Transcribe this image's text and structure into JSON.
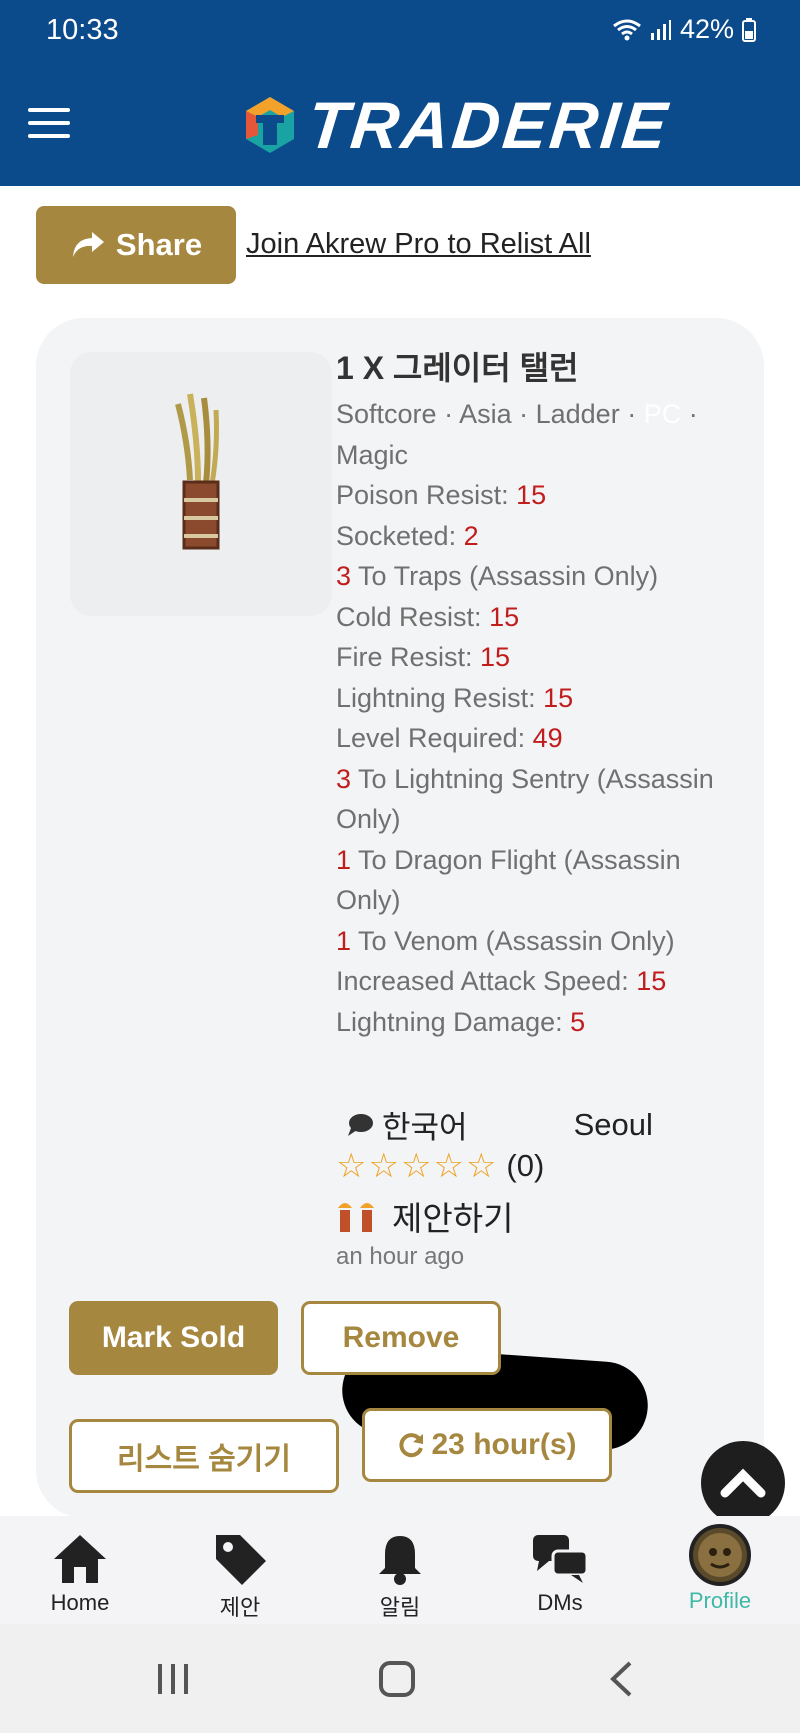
{
  "status": {
    "time": "10:33",
    "battery": "42%"
  },
  "header": {
    "logo_text": "TRADERIE"
  },
  "actions": {
    "share_label": "Share",
    "relist_link": "Join Akrew Pro to Relist All"
  },
  "listing": {
    "title": "1 X 그레이터 탤런",
    "tags": {
      "softcore": "Softcore",
      "region": "Asia",
      "ladder": "Ladder",
      "platform": "PC",
      "rarity": "Magic"
    },
    "properties": [
      {
        "pre": "",
        "label": "Poison Resist: ",
        "value": "15",
        "post": ""
      },
      {
        "pre": "",
        "label": "Socketed: ",
        "value": "2",
        "post": ""
      },
      {
        "pre": "3",
        "label": " To Traps (Assassin Only)",
        "value": "",
        "post": ""
      },
      {
        "pre": "",
        "label": "Cold Resist: ",
        "value": "15",
        "post": ""
      },
      {
        "pre": "",
        "label": "Fire Resist: ",
        "value": "15",
        "post": ""
      },
      {
        "pre": "",
        "label": "Lightning Resist: ",
        "value": "15",
        "post": ""
      },
      {
        "pre": "",
        "label": "Level Required: ",
        "value": "49",
        "post": ""
      },
      {
        "pre": "3",
        "label": " To Lightning Sentry (Assassin Only)",
        "value": "",
        "post": ""
      },
      {
        "pre": "1",
        "label": " To Dragon Flight (Assassin Only)",
        "value": "",
        "post": ""
      },
      {
        "pre": "1",
        "label": " To Venom (Assassin Only)",
        "value": "",
        "post": ""
      },
      {
        "pre": "",
        "label": "Increased Attack Speed: ",
        "value": "15",
        "post": ""
      },
      {
        "pre": "",
        "label": "Lightning Damage: ",
        "value": "5",
        "post": ""
      }
    ],
    "seller": {
      "language": "한국어",
      "location": "Seoul",
      "rating_count": "(0)",
      "stars": 0
    },
    "offer_label": "제안하기",
    "posted": "an hour ago"
  },
  "buttons": {
    "mark_sold": "Mark Sold",
    "remove": "Remove",
    "hide_list": "리스트 숨기기",
    "relist_timer": "23 hour(s)"
  },
  "bottom_nav": [
    {
      "label": "Home",
      "icon": "home-icon",
      "active": false
    },
    {
      "label": "제안",
      "icon": "tag-icon",
      "active": false
    },
    {
      "label": "알림",
      "icon": "bell-icon",
      "active": false
    },
    {
      "label": "DMs",
      "icon": "chat-icon",
      "active": false
    },
    {
      "label": "Profile",
      "icon": "profile-avatar-icon",
      "active": true
    }
  ],
  "colors": {
    "header_bg": "#0b4a8b",
    "gold": "#a6873f",
    "value_red": "#c11d1d",
    "active_tab": "#3fb8a8",
    "star": "#f0a020"
  }
}
